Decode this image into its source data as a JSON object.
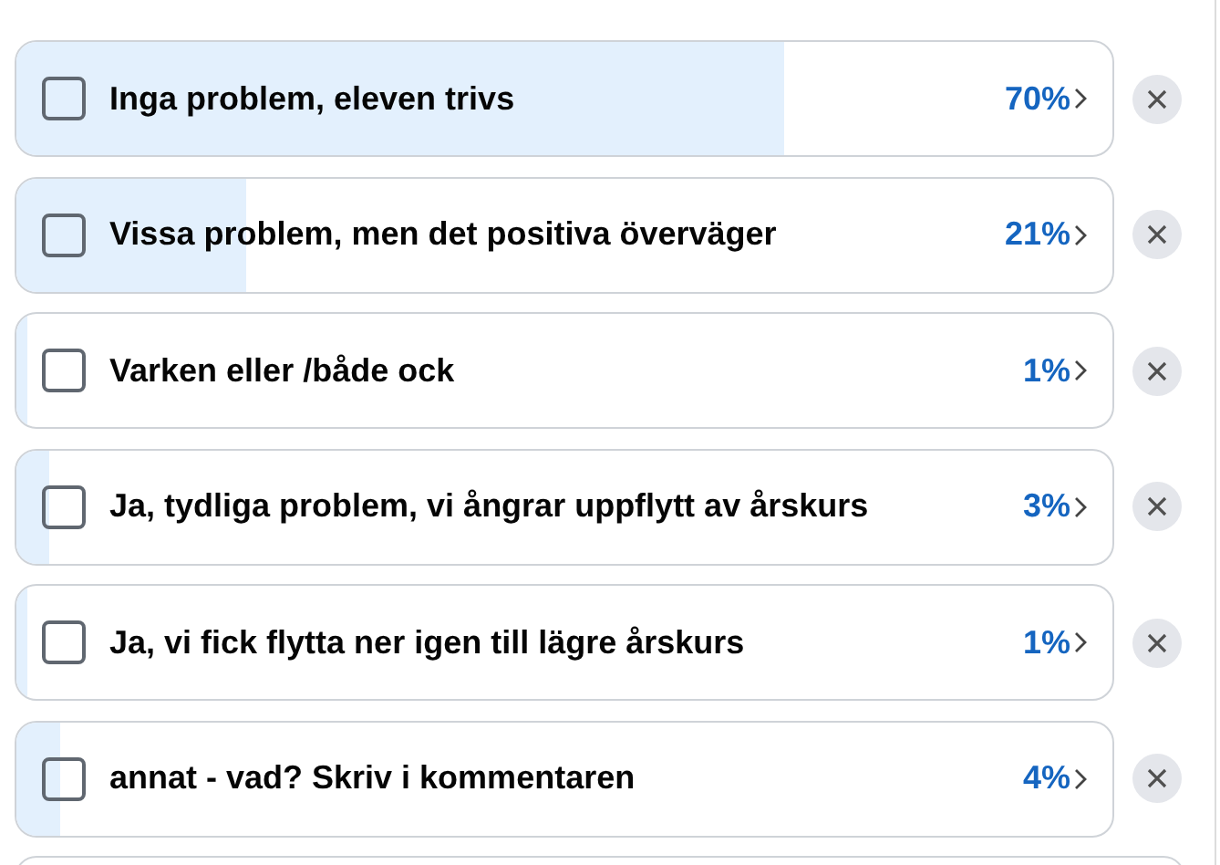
{
  "options": [
    {
      "label": "Inga problem, eleven trivs",
      "percent": "70%",
      "level": 0.7,
      "checked": false
    },
    {
      "label": "Vissa problem, men det positiva överväger",
      "percent": "21%",
      "level": 0.21,
      "checked": false
    },
    {
      "label": "Varken eller /både ock",
      "percent": "1%",
      "level": 0.01,
      "checked": false
    },
    {
      "label": "Ja, tydliga problem, vi ångrar uppflytt av årskurs",
      "percent": "3%",
      "level": 0.03,
      "checked": false
    },
    {
      "label": "Ja, vi fick flytta ner igen till lägre årskurs",
      "percent": "1%",
      "level": 0.01,
      "checked": false
    },
    {
      "label": "annat - vad? Skriv i kommentaren",
      "percent": "4%",
      "level": 0.04,
      "checked": false
    }
  ]
}
